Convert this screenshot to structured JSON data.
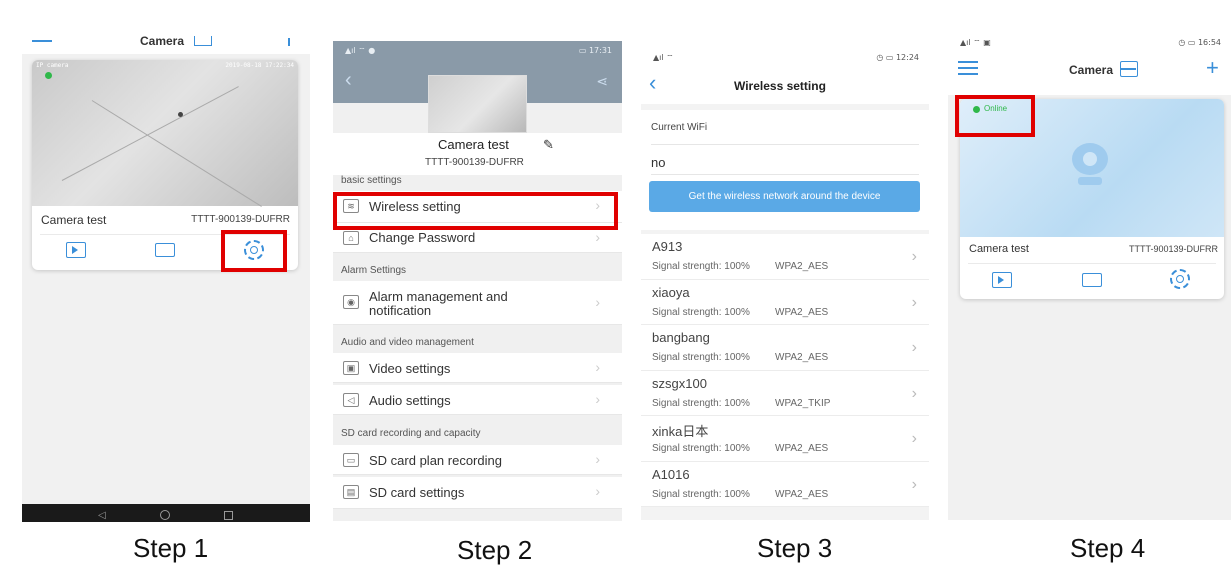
{
  "step_labels": [
    "Step 1",
    "Step 2",
    "Step 3",
    "Step 4"
  ],
  "step1": {
    "header_title": "Camera",
    "video_overlay_tl": "IP camera",
    "video_overlay_tr": "2019-08-18 17:22:34",
    "camera_name": "Camera test",
    "camera_id": "TTTT-900139-DUFRR",
    "icons": [
      "playback-icon",
      "folder-icon",
      "settings-icon"
    ]
  },
  "step2": {
    "status_time": "17:31",
    "camera_name": "Camera test",
    "camera_id": "TTTT-900139-DUFRR",
    "sections": {
      "basic": "basic settings",
      "alarm": "Alarm Settings",
      "av": "Audio and video management",
      "sd": "SD card recording and capacity"
    },
    "items": {
      "wireless": "Wireless setting",
      "password": "Change Password",
      "alarm_line1": "Alarm management and",
      "alarm_line2": "notification",
      "video": "Video settings",
      "audio": "Audio settings",
      "sd_plan": "SD card plan recording",
      "sd_settings": "SD card settings"
    }
  },
  "step3": {
    "status_time": "12:24",
    "title": "Wireless setting",
    "current_wifi_label": "Current WiFi",
    "current_wifi_value": "no",
    "scan_button": "Get the wireless network around the device",
    "networks": [
      {
        "name": "A913",
        "signal": "Signal strength: 100%",
        "enc": "WPA2_AES"
      },
      {
        "name": "xiaoya",
        "signal": "Signal strength: 100%",
        "enc": "WPA2_AES"
      },
      {
        "name": "bangbang",
        "signal": "Signal strength: 100%",
        "enc": "WPA2_AES"
      },
      {
        "name": "szsgx100",
        "signal": "Signal strength: 100%",
        "enc": "WPA2_TKIP"
      },
      {
        "name": "xinka日本",
        "signal": "Signal strength: 100%",
        "enc": "WPA2_AES"
      },
      {
        "name": "A1016",
        "signal": "Signal strength: 100%",
        "enc": "WPA2_AES"
      }
    ]
  },
  "step4": {
    "status_time": "16:54",
    "header_title": "Camera",
    "status_badge": "Online",
    "camera_name": "Camera test",
    "camera_id": "TTTT-900139-DUFRR"
  },
  "colors": {
    "highlight": "#e00000",
    "accent": "#3a8fd9",
    "scan_button": "#5aa9e6",
    "online": "#2fb84a"
  }
}
